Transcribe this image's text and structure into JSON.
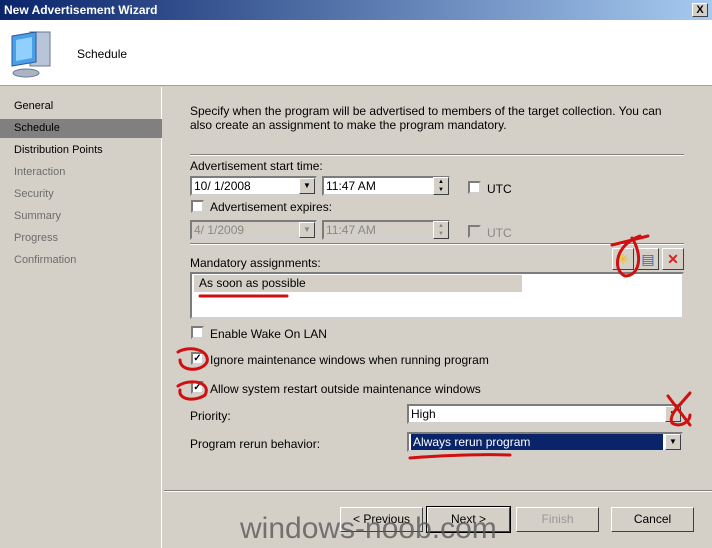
{
  "window": {
    "title": "New Advertisement Wizard",
    "close": "X"
  },
  "header": {
    "title": "Schedule",
    "icon": "computer-icon"
  },
  "nav": {
    "items": [
      {
        "label": "General",
        "state": "normal"
      },
      {
        "label": "Schedule",
        "state": "active"
      },
      {
        "label": "Distribution Points",
        "state": "normal"
      },
      {
        "label": "Interaction",
        "state": "dim"
      },
      {
        "label": "Security",
        "state": "dim"
      },
      {
        "label": "Summary",
        "state": "dim"
      },
      {
        "label": "Progress",
        "state": "dim"
      },
      {
        "label": "Confirmation",
        "state": "dim"
      }
    ]
  },
  "main": {
    "description": "Specify when the program will be advertised to members of the target collection. You can also create an assignment to make the program mandatory.",
    "start_label": "Advertisement start time:",
    "start_date": "10/  1/2008",
    "start_time": "11:47 AM",
    "start_utc": "UTC",
    "start_utc_checked": false,
    "expires_label": "Advertisement expires:",
    "expires_checked": false,
    "expire_date": "4/  1/2009",
    "expire_time": "11:47 AM",
    "expire_utc": "UTC",
    "mandatory_label": "Mandatory assignments:",
    "assignments": [
      "As soon as possible"
    ],
    "wol_label": "Enable Wake On LAN",
    "wol_checked": false,
    "ignore_mw_label": "Ignore maintenance windows when running program",
    "ignore_mw_checked": true,
    "allow_restart_label": "Allow system restart outside maintenance windows",
    "allow_restart_checked": true,
    "priority_label": "Priority:",
    "priority_value": "High",
    "rerun_label": "Program rerun behavior:",
    "rerun_value": "Always rerun program"
  },
  "buttons": {
    "previous": "< Previous",
    "next": "Next >",
    "finish": "Finish",
    "cancel": "Cancel"
  },
  "watermark": "windows-noob.com",
  "colors": {
    "title_start": "#0a246a",
    "selection": "#0a246a",
    "annotation": "#d01010"
  }
}
